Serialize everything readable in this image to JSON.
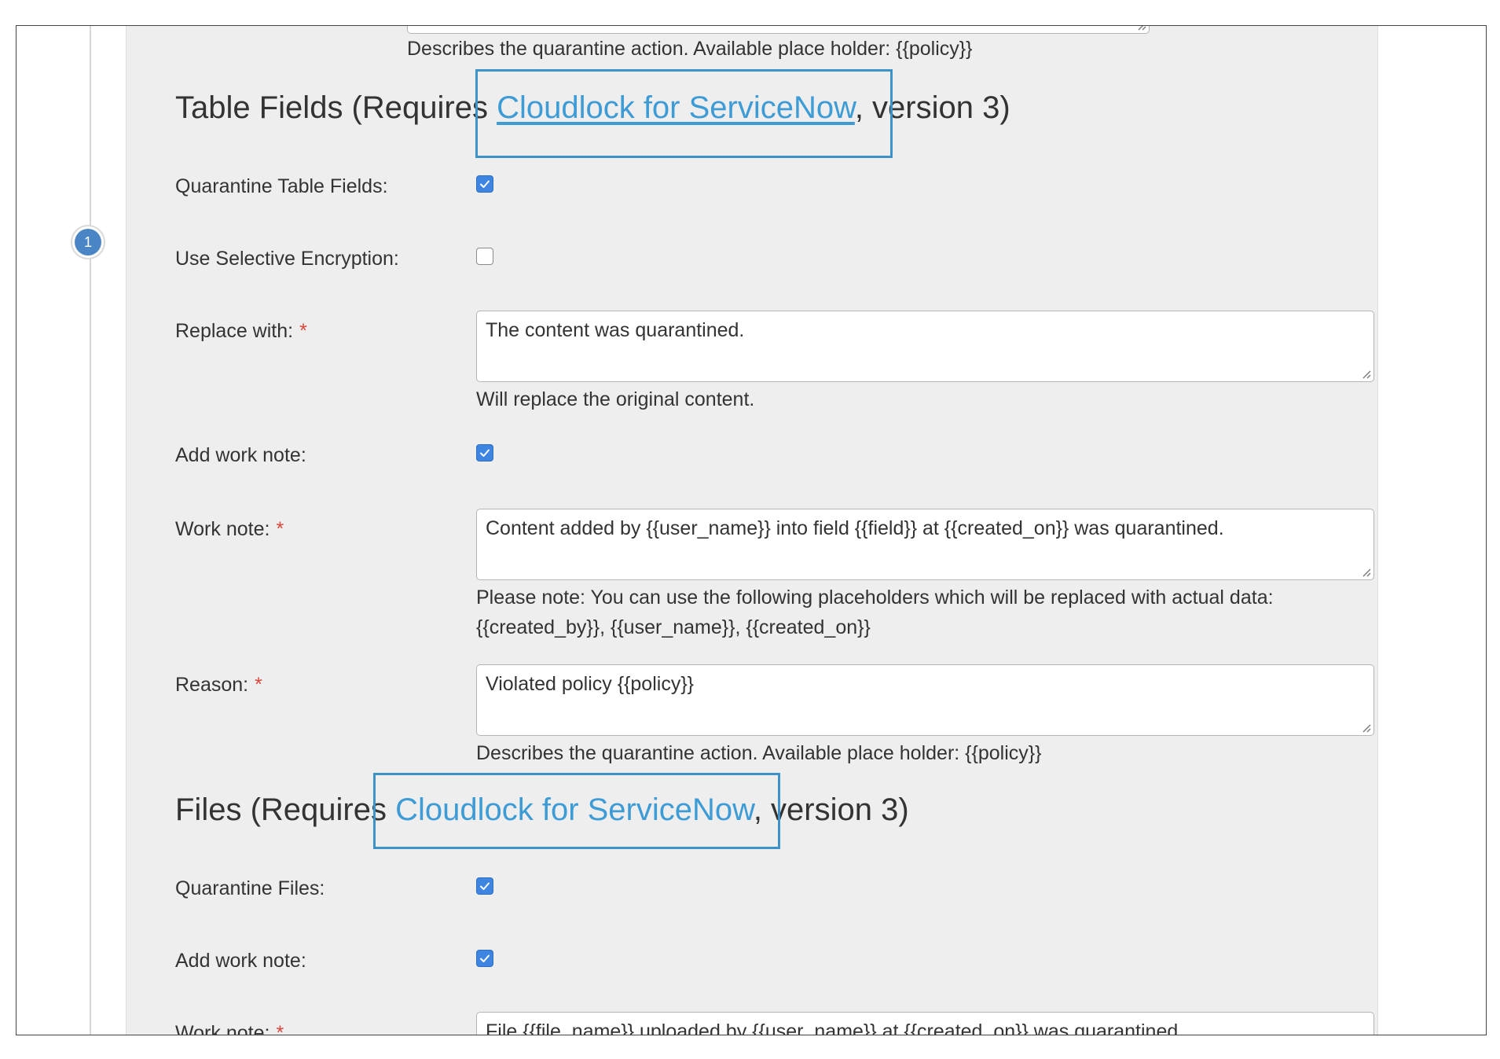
{
  "top_help": "Describes the quarantine action. Available place holder: {{policy}}",
  "step": {
    "number": "1"
  },
  "table_fields": {
    "heading_prefix": "Table Fields (Requires ",
    "heading_link": "Cloudlock for ServiceNow",
    "heading_suffix": ", version 3)",
    "quarantine_label": "Quarantine Table Fields:",
    "quarantine_checked": true,
    "selective_label": "Use Selective Encryption:",
    "selective_checked": false,
    "replace_label": "Replace with:",
    "replace_value": "The content was quarantined.",
    "replace_help": "Will replace the original content.",
    "add_note_label": "Add work note:",
    "add_note_checked": true,
    "work_note_label": "Work note:",
    "work_note_value": "Content added by {{user_name}} into field {{field}} at {{created_on}} was quarantined.",
    "work_note_help_1": "Please note: You can use the following placeholders which will be replaced with actual data:",
    "work_note_help_2": "{{created_by}}, {{user_name}}, {{created_on}}",
    "reason_label": "Reason:",
    "reason_value": "Violated policy {{policy}}",
    "reason_help": "Describes the quarantine action. Available place holder: {{policy}}"
  },
  "files": {
    "heading_prefix": "Files (Requires ",
    "heading_link": "Cloudlock for ServiceNow",
    "heading_suffix": ", version 3)",
    "quarantine_label": "Quarantine Files:",
    "quarantine_checked": true,
    "add_note_label": "Add work note:",
    "add_note_checked": true,
    "work_note_label": "Work note:",
    "work_note_value": "File {{file_name}} uploaded by {{user_name}} at {{created_on}} was quarantined."
  },
  "required_marker": "*",
  "colors": {
    "accent": "#3d9bd6",
    "checkbox": "#3d85e0",
    "required": "#d9473b",
    "panel": "#eeeeee",
    "step": "#4a86c5"
  }
}
